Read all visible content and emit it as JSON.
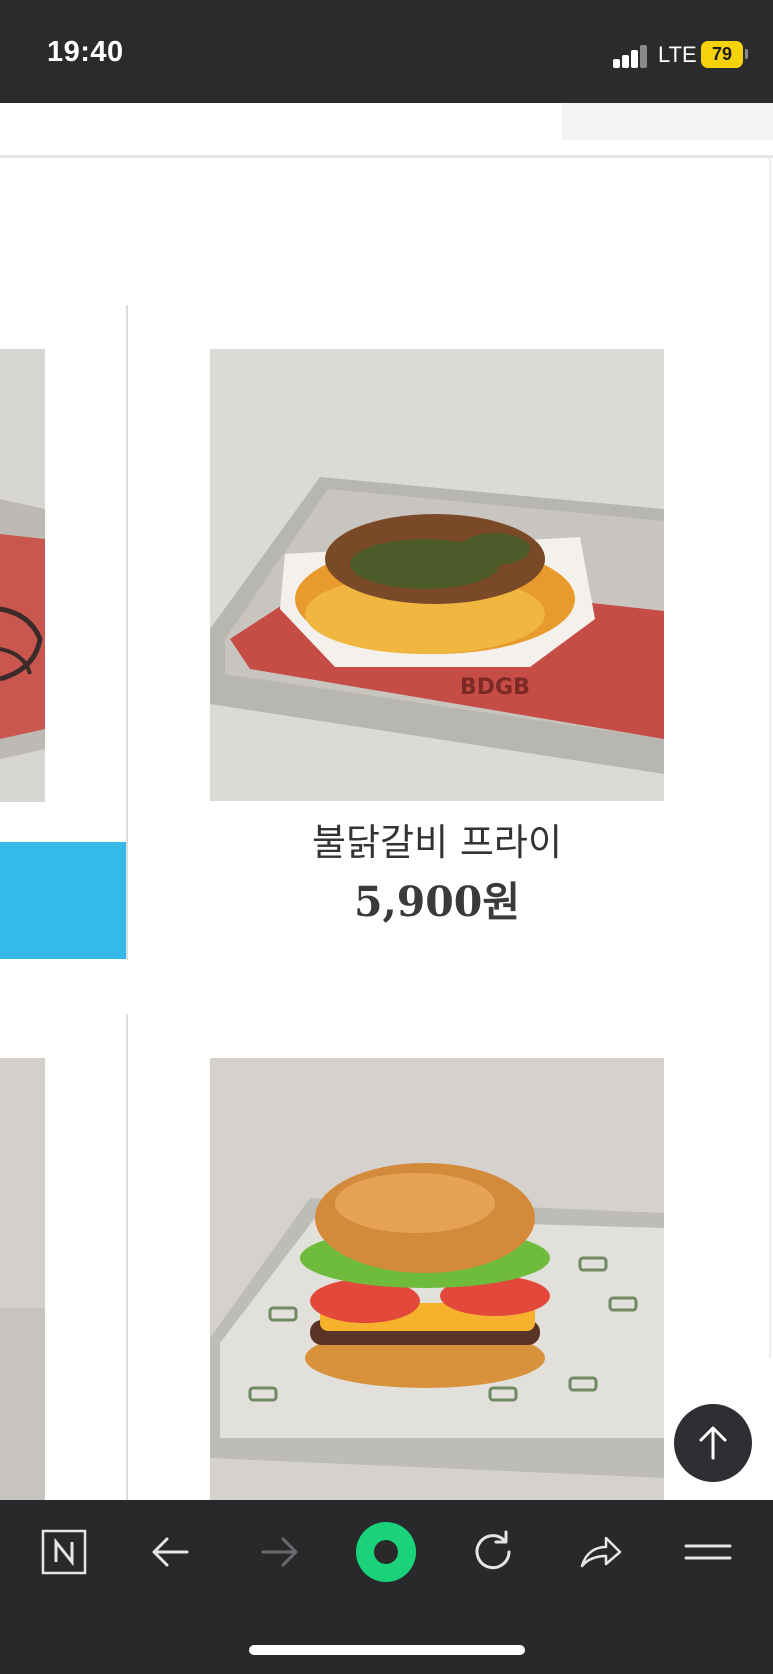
{
  "status_bar": {
    "time": "19:40",
    "network": "LTE",
    "battery": "79"
  },
  "products": [
    {
      "name": "불닭갈비 프라이",
      "price": "5,900원",
      "image": "fries-tray-photo"
    },
    {
      "name": "",
      "price": "",
      "image": "cheeseburger-tray-photo"
    }
  ],
  "toolbar": {
    "icons": [
      "naver-n-icon",
      "back-arrow-icon",
      "forward-arrow-icon",
      "green-dot-icon",
      "refresh-icon",
      "share-icon",
      "menu-icon"
    ]
  },
  "colors": {
    "status_bg": "#2b2b2e",
    "toolbar_bg": "#29292c",
    "accent_blue": "#35b9e8",
    "accent_green": "#19d27a",
    "battery": "#f5d20a"
  }
}
